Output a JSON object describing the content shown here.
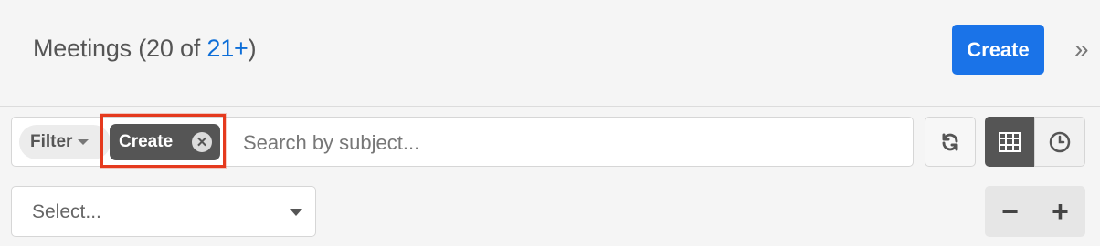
{
  "header": {
    "title_prefix": "Meetings (20 of ",
    "title_link": "21+",
    "title_suffix": ")",
    "create_label": "Create",
    "expand_icon": "»"
  },
  "search": {
    "filter_label": "Filter",
    "active_filter_tag": "Create",
    "remove_glyph": "✕",
    "placeholder": "Search by subject..."
  },
  "toolbar": {
    "refresh_icon": "refresh-icon",
    "list_view_icon": "grid-icon",
    "activity_view_icon": "clock-icon"
  },
  "select": {
    "placeholder": "Select..."
  },
  "zoom": {
    "minus": "−",
    "plus": "+"
  },
  "colors": {
    "accent": "#1a73e8",
    "highlight": "#e53a1e",
    "tag_bg": "#555555"
  }
}
